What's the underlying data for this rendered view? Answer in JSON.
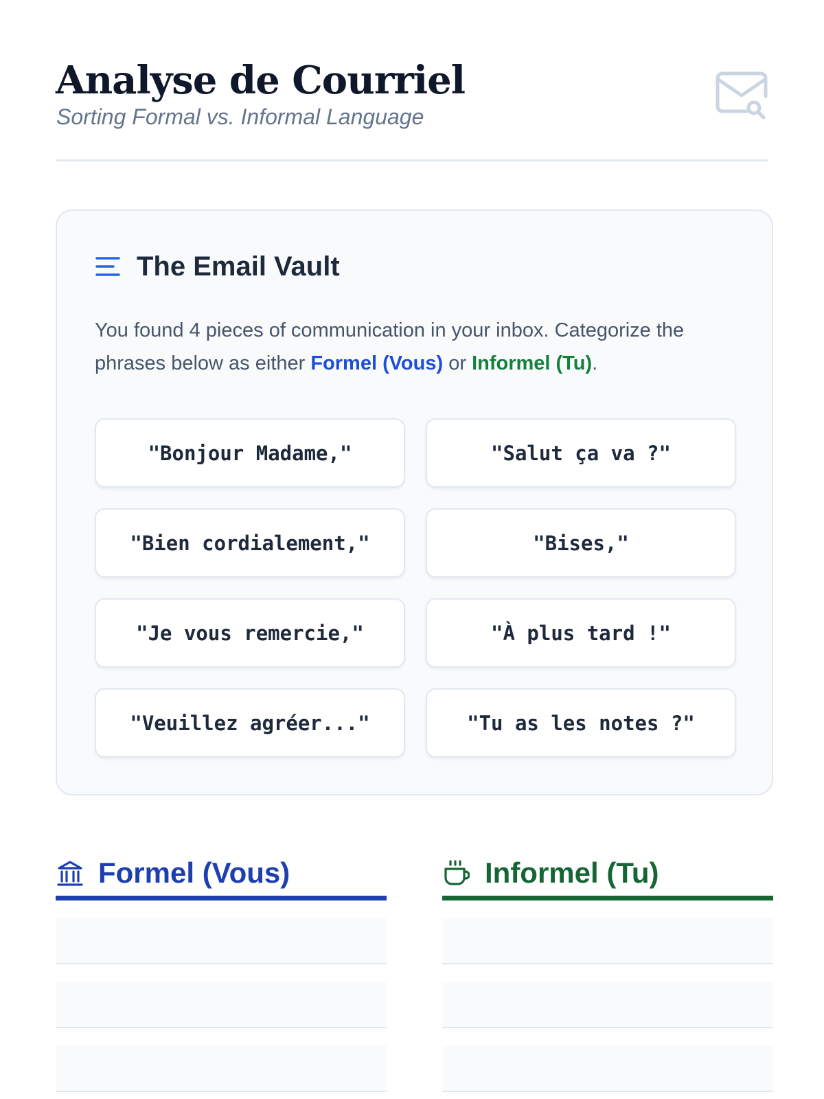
{
  "header": {
    "title": "Analyse de Courriel",
    "subtitle": "Sorting Formal vs. Informal Language",
    "icon": "mail-search-icon"
  },
  "vault": {
    "title": "The Email Vault",
    "icon": "list-icon",
    "description_prefix": "You found 4 pieces of communication in your inbox. Categorize the phrases below as either ",
    "formal_keyword": "Formel (Vous)",
    "connector": " or ",
    "informal_keyword": "Informel (Tu)",
    "description_suffix": ".",
    "phrases": [
      "\"Bonjour Madame,\"",
      "\"Salut ça va ?\"",
      "\"Bien cordialement,\"",
      "\"Bises,\"",
      "\"Je vous remercie,\"",
      "\"À plus tard !\"",
      "\"Veuillez agréer...\"",
      "\"Tu as les notes ?\""
    ]
  },
  "buckets": {
    "formal": {
      "title": "Formel (Vous)",
      "icon": "bank-icon",
      "color": "#1e40af"
    },
    "informal": {
      "title": "Informel (Tu)",
      "icon": "coffee-cup-icon",
      "color": "#166534"
    }
  },
  "colors": {
    "formal_accent": "#1d4ed8",
    "informal_accent": "#15803d",
    "card_bg": "#f8fafc",
    "border": "#e2e8f0"
  }
}
